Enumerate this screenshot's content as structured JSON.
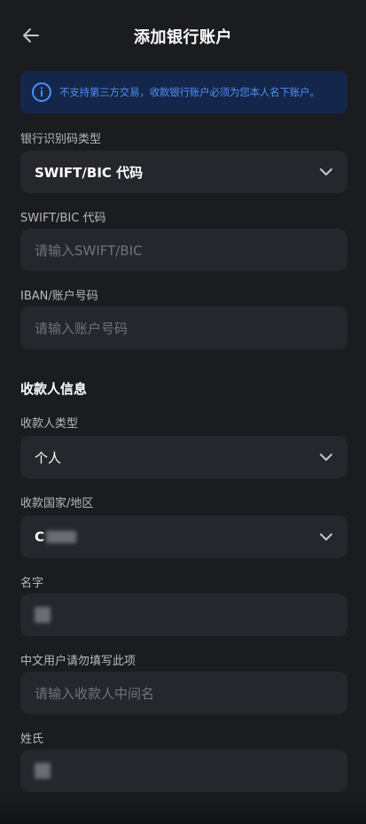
{
  "header": {
    "title": "添加银行账户"
  },
  "notice": {
    "text": "不支持第三方交易，收款银行账户必须为您本人名下账户。"
  },
  "bank_code_type": {
    "label": "银行识别码类型",
    "value": "SWIFT/BIC 代码"
  },
  "swift": {
    "label": "SWIFT/BIC 代码",
    "placeholder": "请输入SWIFT/BIC"
  },
  "iban": {
    "label": "IBAN/账户号码",
    "placeholder": "请输入账户号码"
  },
  "payee": {
    "section_title": "收款人信息",
    "type_label": "收款人类型",
    "type_value": "个人",
    "country_label": "收款国家/地区",
    "country_value": "C",
    "first_name_label": "名字",
    "middle_name_label": "中文用户请勿填写此项",
    "middle_name_placeholder": "请输入收款人中间名",
    "last_name_label": "姓氏"
  },
  "colors": {
    "accent": "#4e8ff3",
    "notice_bg": "#14274a",
    "field_bg": "#26272d",
    "page_bg": "#1b1c20"
  }
}
